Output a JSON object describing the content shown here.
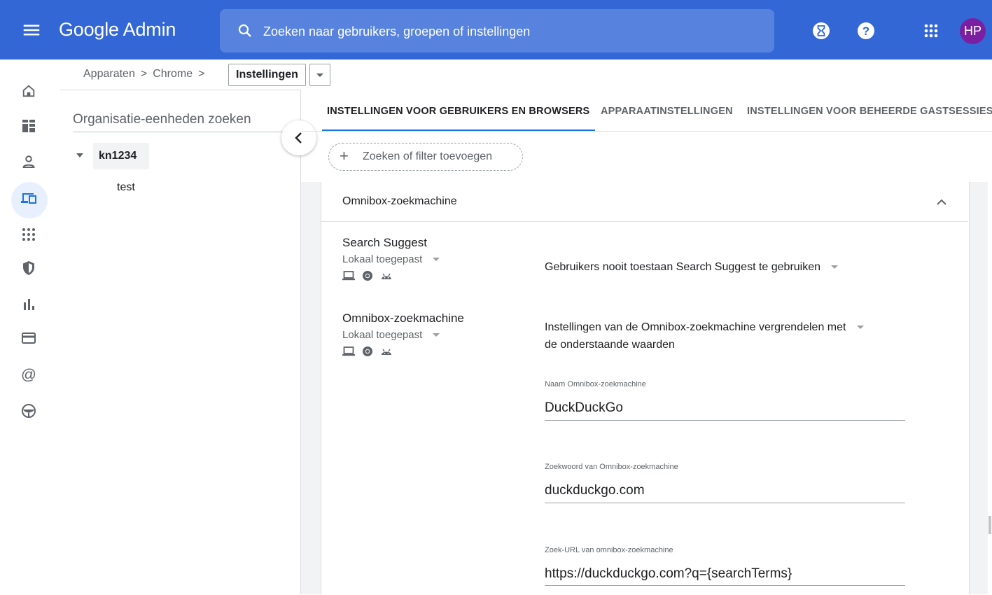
{
  "app": {
    "logo_text": "Google Admin"
  },
  "search": {
    "placeholder": "Zoeken naar gebruikers, groepen of instellingen"
  },
  "topbar": {
    "icons": [
      "menu-icon",
      "search-icon",
      "hourglass-icon",
      "help-icon",
      "apps-grid-icon"
    ],
    "avatar_initials": "HP",
    "avatar_color": "#7b1fa2",
    "bar_color": "#3367d6"
  },
  "rail": {
    "icons": [
      "home-icon",
      "dashboard-icon",
      "user-icon",
      "devices-icon",
      "apps-icon",
      "security-icon",
      "reports-icon",
      "billing-icon",
      "account-icon",
      "rules-icon"
    ],
    "active": "devices-icon"
  },
  "breadcrumb": {
    "items": [
      "Apparaten",
      "Chrome"
    ],
    "separator": ">",
    "current": "Instellingen"
  },
  "org": {
    "search_placeholder": "Organisatie-eenheden zoeken",
    "root": "kn1234",
    "children": [
      "test"
    ]
  },
  "tabs": [
    {
      "label": "INSTELLINGEN VOOR GEBRUIKERS EN BROWSERS",
      "active": true
    },
    {
      "label": "APPARAATINSTELLINGEN",
      "active": false
    },
    {
      "label": "INSTELLINGEN VOOR BEHEERDE GASTSESSIES",
      "active": false
    }
  ],
  "filter": {
    "label": "Zoeken of filter toevoegen"
  },
  "section": {
    "title": "Omnibox-zoekmachine",
    "settings": [
      {
        "title": "Search Suggest",
        "applied": "Lokaal toegepast",
        "platform_icons": [
          "laptop-icon",
          "chrome-icon",
          "android-icon"
        ],
        "value": "Gebruikers nooit toestaan Search Suggest te gebruiken"
      },
      {
        "title": "Omnibox-zoekmachine",
        "applied": "Lokaal toegepast",
        "platform_icons": [
          "laptop-icon",
          "chrome-icon",
          "android-icon"
        ],
        "value_line1": "Instellingen van de Omnibox-zoekmachine vergrendelen met",
        "value_line2": "de onderstaande waarden",
        "fields": [
          {
            "label": "Naam Omnibox-zoekmachine",
            "value": "DuckDuckGo"
          },
          {
            "label": "Zoekwoord van Omnibox-zoekmachine",
            "value": "duckduckgo.com"
          },
          {
            "label": "Zoek-URL van omnibox-zoekmachine",
            "value": "https://duckduckgo.com?q={searchTerms}"
          }
        ]
      }
    ]
  },
  "colors": {
    "accent": "#1a73e8",
    "active_bg": "#e8f0fe",
    "content_bg": "#f1f3f4"
  }
}
